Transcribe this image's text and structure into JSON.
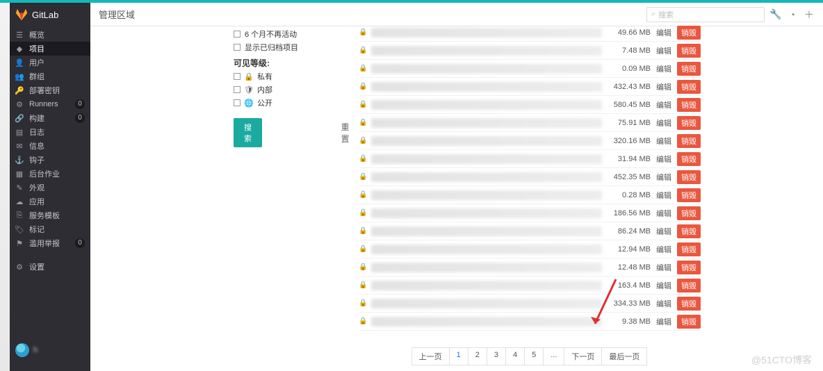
{
  "brand": "GitLab",
  "header": {
    "title": "管理区域",
    "search_placeholder": "搜索"
  },
  "sidebar": {
    "items": [
      {
        "icon": "dash",
        "label": "概览",
        "badge": null,
        "active": false
      },
      {
        "icon": "cube",
        "label": "项目",
        "badge": null,
        "active": true
      },
      {
        "icon": "user",
        "label": "用户",
        "badge": null,
        "active": false
      },
      {
        "icon": "group",
        "label": "群组",
        "badge": null,
        "active": false
      },
      {
        "icon": "key",
        "label": "部署密钥",
        "badge": null,
        "active": false
      },
      {
        "icon": "gear",
        "label": "Runners",
        "badge": "0",
        "active": false
      },
      {
        "icon": "link",
        "label": "构建",
        "badge": "0",
        "active": false
      },
      {
        "icon": "file",
        "label": "日志",
        "badge": null,
        "active": false
      },
      {
        "icon": "msg",
        "label": "信息",
        "badge": null,
        "active": false
      },
      {
        "icon": "hook",
        "label": "钩子",
        "badge": null,
        "active": false
      },
      {
        "icon": "bg",
        "label": "后台作业",
        "badge": null,
        "active": false
      },
      {
        "icon": "paint",
        "label": "外观",
        "badge": null,
        "active": false
      },
      {
        "icon": "cloud",
        "label": "应用",
        "badge": null,
        "active": false
      },
      {
        "icon": "tpl",
        "label": "服务模板",
        "badge": null,
        "active": false
      },
      {
        "icon": "tag",
        "label": "标记",
        "badge": null,
        "active": false
      },
      {
        "icon": "flag",
        "label": "滥用举报",
        "badge": "0",
        "active": false
      }
    ],
    "settings": {
      "icon": "gear",
      "label": "设置"
    },
    "username": "h"
  },
  "filters": {
    "inactive6mo": "6 个月不再活动",
    "show_archived": "显示已归档项目",
    "visibility_header": "可见等级:",
    "private": "私有",
    "internal": "内部",
    "public": "公开",
    "search_btn": "搜索",
    "reset_btn": "重置"
  },
  "projects": [
    {
      "size": "49.66 MB"
    },
    {
      "size": "7.48 MB"
    },
    {
      "size": "0.09 MB"
    },
    {
      "size": "432.43 MB"
    },
    {
      "size": "580.45 MB"
    },
    {
      "size": "75.91 MB"
    },
    {
      "size": "320.16 MB"
    },
    {
      "size": "31.94 MB"
    },
    {
      "size": "452.35 MB"
    },
    {
      "size": "0.28 MB"
    },
    {
      "size": "186.56 MB"
    },
    {
      "size": "86.24 MB"
    },
    {
      "size": "12.94 MB"
    },
    {
      "size": "12.48 MB"
    },
    {
      "size": "163.4 MB"
    },
    {
      "size": "334.33 MB"
    },
    {
      "size": "9.38 MB"
    }
  ],
  "row_labels": {
    "edit": "编辑",
    "delete": "销毁"
  },
  "pager": {
    "prev": "上一页",
    "pages": [
      "1",
      "2",
      "3",
      "4",
      "5",
      "..."
    ],
    "next": "下一页",
    "last": "最后一页"
  },
  "watermark": "@51CTO博客"
}
